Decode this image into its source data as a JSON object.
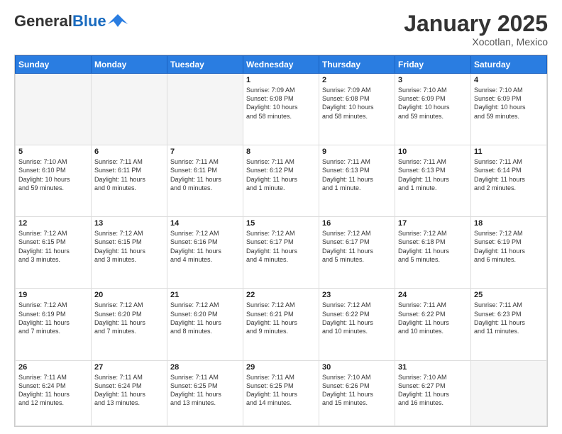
{
  "header": {
    "logo_general": "General",
    "logo_blue": "Blue",
    "month_title": "January 2025",
    "location": "Xocotlan, Mexico"
  },
  "days_of_week": [
    "Sunday",
    "Monday",
    "Tuesday",
    "Wednesday",
    "Thursday",
    "Friday",
    "Saturday"
  ],
  "weeks": [
    [
      {
        "day": "",
        "info": ""
      },
      {
        "day": "",
        "info": ""
      },
      {
        "day": "",
        "info": ""
      },
      {
        "day": "1",
        "info": "Sunrise: 7:09 AM\nSunset: 6:08 PM\nDaylight: 10 hours\nand 58 minutes."
      },
      {
        "day": "2",
        "info": "Sunrise: 7:09 AM\nSunset: 6:08 PM\nDaylight: 10 hours\nand 58 minutes."
      },
      {
        "day": "3",
        "info": "Sunrise: 7:10 AM\nSunset: 6:09 PM\nDaylight: 10 hours\nand 59 minutes."
      },
      {
        "day": "4",
        "info": "Sunrise: 7:10 AM\nSunset: 6:09 PM\nDaylight: 10 hours\nand 59 minutes."
      }
    ],
    [
      {
        "day": "5",
        "info": "Sunrise: 7:10 AM\nSunset: 6:10 PM\nDaylight: 10 hours\nand 59 minutes."
      },
      {
        "day": "6",
        "info": "Sunrise: 7:11 AM\nSunset: 6:11 PM\nDaylight: 11 hours\nand 0 minutes."
      },
      {
        "day": "7",
        "info": "Sunrise: 7:11 AM\nSunset: 6:11 PM\nDaylight: 11 hours\nand 0 minutes."
      },
      {
        "day": "8",
        "info": "Sunrise: 7:11 AM\nSunset: 6:12 PM\nDaylight: 11 hours\nand 1 minute."
      },
      {
        "day": "9",
        "info": "Sunrise: 7:11 AM\nSunset: 6:13 PM\nDaylight: 11 hours\nand 1 minute."
      },
      {
        "day": "10",
        "info": "Sunrise: 7:11 AM\nSunset: 6:13 PM\nDaylight: 11 hours\nand 1 minute."
      },
      {
        "day": "11",
        "info": "Sunrise: 7:11 AM\nSunset: 6:14 PM\nDaylight: 11 hours\nand 2 minutes."
      }
    ],
    [
      {
        "day": "12",
        "info": "Sunrise: 7:12 AM\nSunset: 6:15 PM\nDaylight: 11 hours\nand 3 minutes."
      },
      {
        "day": "13",
        "info": "Sunrise: 7:12 AM\nSunset: 6:15 PM\nDaylight: 11 hours\nand 3 minutes."
      },
      {
        "day": "14",
        "info": "Sunrise: 7:12 AM\nSunset: 6:16 PM\nDaylight: 11 hours\nand 4 minutes."
      },
      {
        "day": "15",
        "info": "Sunrise: 7:12 AM\nSunset: 6:17 PM\nDaylight: 11 hours\nand 4 minutes."
      },
      {
        "day": "16",
        "info": "Sunrise: 7:12 AM\nSunset: 6:17 PM\nDaylight: 11 hours\nand 5 minutes."
      },
      {
        "day": "17",
        "info": "Sunrise: 7:12 AM\nSunset: 6:18 PM\nDaylight: 11 hours\nand 5 minutes."
      },
      {
        "day": "18",
        "info": "Sunrise: 7:12 AM\nSunset: 6:19 PM\nDaylight: 11 hours\nand 6 minutes."
      }
    ],
    [
      {
        "day": "19",
        "info": "Sunrise: 7:12 AM\nSunset: 6:19 PM\nDaylight: 11 hours\nand 7 minutes."
      },
      {
        "day": "20",
        "info": "Sunrise: 7:12 AM\nSunset: 6:20 PM\nDaylight: 11 hours\nand 7 minutes."
      },
      {
        "day": "21",
        "info": "Sunrise: 7:12 AM\nSunset: 6:20 PM\nDaylight: 11 hours\nand 8 minutes."
      },
      {
        "day": "22",
        "info": "Sunrise: 7:12 AM\nSunset: 6:21 PM\nDaylight: 11 hours\nand 9 minutes."
      },
      {
        "day": "23",
        "info": "Sunrise: 7:12 AM\nSunset: 6:22 PM\nDaylight: 11 hours\nand 10 minutes."
      },
      {
        "day": "24",
        "info": "Sunrise: 7:11 AM\nSunset: 6:22 PM\nDaylight: 11 hours\nand 10 minutes."
      },
      {
        "day": "25",
        "info": "Sunrise: 7:11 AM\nSunset: 6:23 PM\nDaylight: 11 hours\nand 11 minutes."
      }
    ],
    [
      {
        "day": "26",
        "info": "Sunrise: 7:11 AM\nSunset: 6:24 PM\nDaylight: 11 hours\nand 12 minutes."
      },
      {
        "day": "27",
        "info": "Sunrise: 7:11 AM\nSunset: 6:24 PM\nDaylight: 11 hours\nand 13 minutes."
      },
      {
        "day": "28",
        "info": "Sunrise: 7:11 AM\nSunset: 6:25 PM\nDaylight: 11 hours\nand 13 minutes."
      },
      {
        "day": "29",
        "info": "Sunrise: 7:11 AM\nSunset: 6:25 PM\nDaylight: 11 hours\nand 14 minutes."
      },
      {
        "day": "30",
        "info": "Sunrise: 7:10 AM\nSunset: 6:26 PM\nDaylight: 11 hours\nand 15 minutes."
      },
      {
        "day": "31",
        "info": "Sunrise: 7:10 AM\nSunset: 6:27 PM\nDaylight: 11 hours\nand 16 minutes."
      },
      {
        "day": "",
        "info": ""
      }
    ]
  ]
}
